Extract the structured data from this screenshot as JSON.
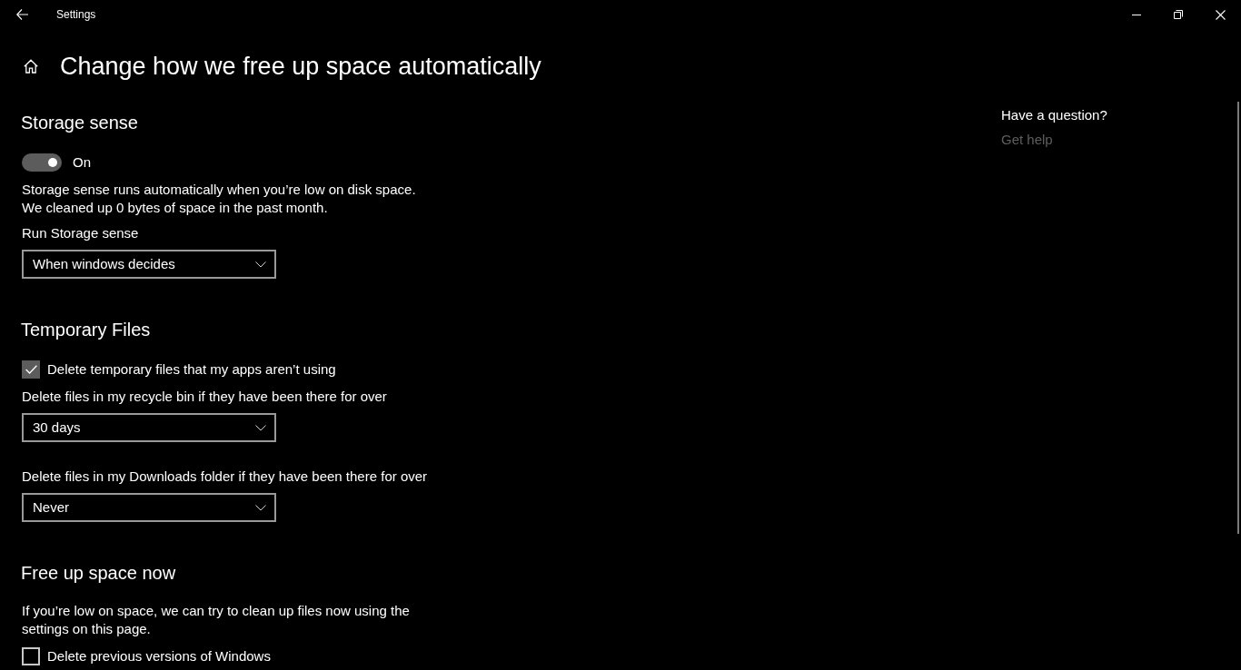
{
  "window": {
    "title": "Settings"
  },
  "page": {
    "title": "Change how we free up space automatically"
  },
  "sections": [
    {
      "heading": "Storage sense",
      "items": [
        {
          "kind": "toggle",
          "on": true,
          "label": "On"
        },
        {
          "kind": "text",
          "lines": [
            "Storage sense runs automatically when you’re low on disk space.",
            "We cleaned up 0 bytes of space in the past month."
          ]
        },
        {
          "kind": "dropdown",
          "label": "Run Storage sense",
          "value": "When windows decides"
        }
      ]
    },
    {
      "heading": "Temporary Files",
      "items": [
        {
          "kind": "checkbox",
          "checked": true,
          "label": "Delete temporary files that my apps aren’t using"
        },
        {
          "kind": "dropdown",
          "label": "Delete files in my recycle bin if they have been there for over",
          "value": "30 days"
        },
        {
          "kind": "dropdown",
          "label": "Delete files in my Downloads folder if they have been there for over",
          "value": "Never"
        }
      ]
    },
    {
      "heading": "Free up space now",
      "items": [
        {
          "kind": "text",
          "lines": [
            "If you’re low on space, we can try to clean up files now using the settings on this page."
          ]
        },
        {
          "kind": "checkbox",
          "checked": false,
          "label": "Delete previous versions of Windows"
        }
      ]
    }
  ],
  "help": {
    "heading": "Have a question?",
    "link": "Get help"
  }
}
